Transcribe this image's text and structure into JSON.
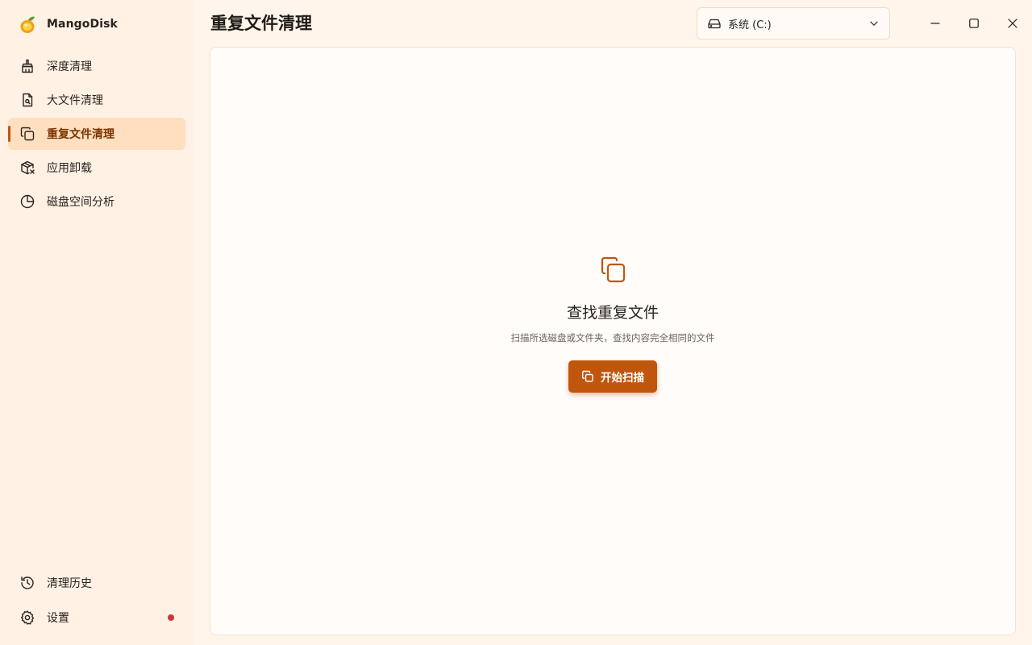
{
  "app": {
    "name": "MangoDisk",
    "logo_icon": "mango-logo-icon",
    "accent_color": "#c0560b"
  },
  "sidebar": {
    "items": [
      {
        "label": "深度清理",
        "icon": "broom-icon",
        "active": false
      },
      {
        "label": "大文件清理",
        "icon": "file-search-icon",
        "active": false
      },
      {
        "label": "重复文件清理",
        "icon": "copy-icon",
        "active": true
      },
      {
        "label": "应用卸载",
        "icon": "package-remove-icon",
        "active": false
      },
      {
        "label": "磁盘空间分析",
        "icon": "pie-chart-icon",
        "active": false
      }
    ],
    "bottom_items": [
      {
        "label": "清理历史",
        "icon": "history-icon"
      },
      {
        "label": "设置",
        "icon": "gear-icon",
        "badge": "red-dot"
      }
    ]
  },
  "header": {
    "title": "重复文件清理",
    "drive_select": {
      "value": "系统 (C:)",
      "icon": "hard-drive-icon"
    }
  },
  "window_controls": [
    "minimize-icon",
    "maximize-icon",
    "close-icon"
  ],
  "main": {
    "empty_state": {
      "icon": "copy-icon",
      "title": "查找重复文件",
      "description": "扫描所选磁盘或文件夹，查找内容完全相同的文件",
      "button_label": "开始扫描"
    }
  }
}
